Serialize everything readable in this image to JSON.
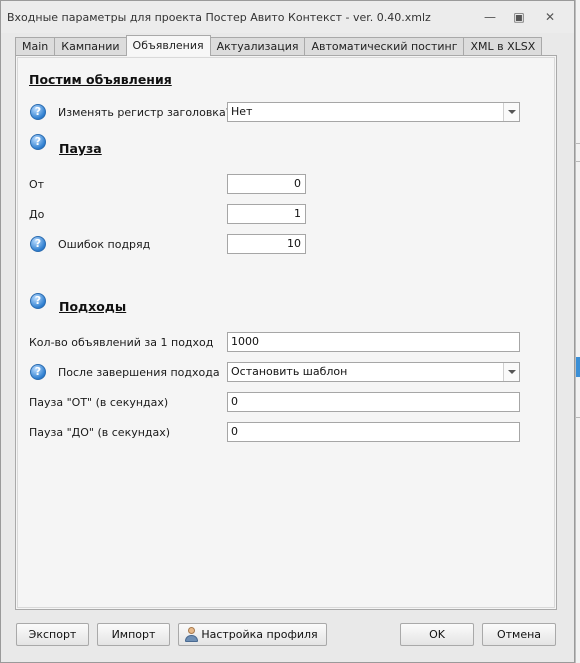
{
  "window": {
    "title": "Входные параметры для проекта Постер Авито Контекст - ver. 0.40.xmlz",
    "minimize_glyph": "—",
    "restore_glyph": "▣",
    "close_glyph": "✕"
  },
  "tabs": [
    {
      "label": "Main",
      "active": false
    },
    {
      "label": "Кампании",
      "active": false
    },
    {
      "label": "Объявления",
      "active": true
    },
    {
      "label": "Актуализация",
      "active": false
    },
    {
      "label": "Автоматический постинг",
      "active": false
    },
    {
      "label": "XML в XLSX",
      "active": false
    }
  ],
  "help_icon_glyph": "?",
  "form": {
    "posting_section_title": "Постим объявления",
    "change_case_label": "Изменять регистр заголовка?",
    "change_case_value": "Нет",
    "pause_section_title": "Пауза",
    "from_label": "От",
    "from_value": "0",
    "to_label": "До",
    "to_value": "1",
    "errors_label": "Ошибок подряд",
    "errors_value": "10",
    "approaches_section_title": "Подходы",
    "ads_per_approach_label": "Кол-во объявлений за 1 подход",
    "ads_per_approach_value": "1000",
    "after_approach_label": "После завершения подхода",
    "after_approach_value": "Остановить шаблон",
    "pause_from_sec_label": "Пауза \"ОТ\" (в секундах)",
    "pause_from_sec_value": "0",
    "pause_to_sec_label": "Пауза \"ДО\" (в секундах)",
    "pause_to_sec_value": "0"
  },
  "footer": {
    "export_label": "Экспорт",
    "import_label": "Импорт",
    "profile_settings_label": "Настройка профиля",
    "ok_label": "OK",
    "cancel_label": "Отмена"
  },
  "icons": {
    "help": "help-icon",
    "user": "user-icon",
    "dropdown": "chevron-down-icon"
  }
}
